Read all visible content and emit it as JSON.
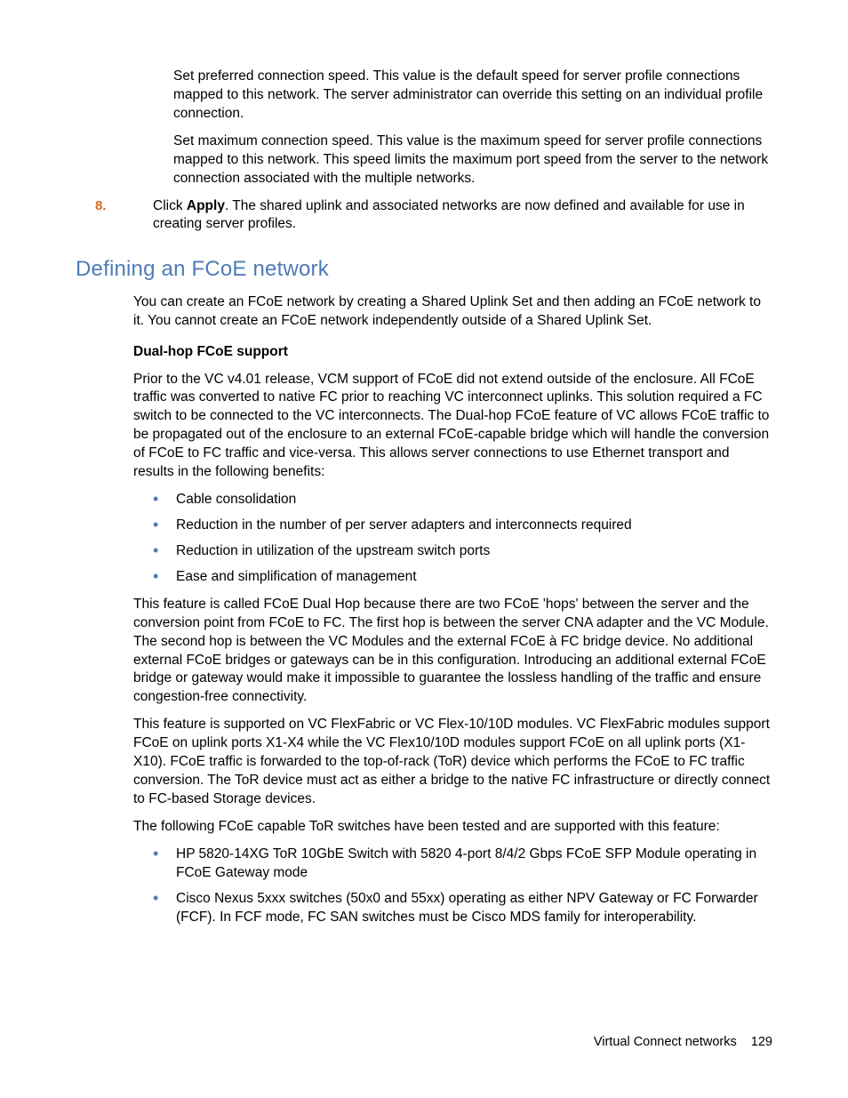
{
  "top": {
    "para1": "Set preferred connection speed. This value is the default speed for server profile connections mapped to this network. The server administrator can override this setting on an individual profile connection.",
    "para2": "Set maximum connection speed. This value is the maximum speed for server profile connections mapped to this network. This speed limits the maximum port speed from the server to the network connection associated with the multiple networks."
  },
  "step8": {
    "num": "8.",
    "pre": "Click ",
    "bold": "Apply",
    "post": ". The shared uplink and associated networks are now defined and available for use in creating server profiles."
  },
  "section_heading": "Defining an FCoE network",
  "intro": "You can create an FCoE network by creating a Shared Uplink Set and then adding an FCoE network to it. You cannot create an FCoE network independently outside of a Shared Uplink Set.",
  "subheading": "Dual-hop FCoE support",
  "p_prior": "Prior to the VC v4.01 release, VCM support of FCoE did not extend outside of the enclosure. All FCoE traffic was converted to native FC prior to reaching VC interconnect uplinks. This solution required a FC switch to be connected to the VC interconnects. The Dual-hop FCoE feature of VC allows FCoE traffic to be propagated out of the enclosure to an external FCoE-capable bridge which will handle the conversion of FCoE to FC traffic and vice-versa. This allows server connections to use Ethernet transport and results in the following benefits:",
  "benefits": [
    "Cable consolidation",
    "Reduction in the number of per server adapters and interconnects required",
    "Reduction in utilization of the upstream switch ports",
    "Ease and simplification of management"
  ],
  "p_dualhop": "This feature is called FCoE Dual Hop because there are two FCoE 'hops' between the server and the conversion point from FCoE to FC. The first hop is between the server CNA adapter and the VC Module. The second hop is between the VC Modules and the external FCoE à FC bridge device. No additional external FCoE bridges or gateways can be in this configuration. Introducing an additional external FCoE bridge or gateway would make it impossible to guarantee the lossless handling of the traffic and ensure congestion-free connectivity.",
  "p_support": "This feature is supported on VC FlexFabric or VC Flex-10/10D modules. VC FlexFabric modules support FCoE on uplink ports X1-X4 while the VC Flex10/10D modules support FCoE on all uplink ports (X1-X10). FCoE traffic is forwarded to the top-of-rack (ToR) device which performs the FCoE to FC traffic conversion. The ToR device must act as either a bridge to the native FC infrastructure or directly connect to FC-based Storage devices.",
  "p_tor": "The following FCoE capable ToR switches have been tested and are supported with this feature:",
  "switches": [
    "HP 5820-14XG ToR 10GbE Switch with 5820 4-port 8/4/2 Gbps FCoE SFP Module operating in FCoE Gateway mode",
    "Cisco Nexus 5xxx switches (50x0 and 55xx) operating as either NPV Gateway or FC Forwarder (FCF). In FCF mode, FC SAN switches must be Cisco MDS family for interoperability."
  ],
  "footer": {
    "label": "Virtual Connect networks",
    "page": "129"
  }
}
